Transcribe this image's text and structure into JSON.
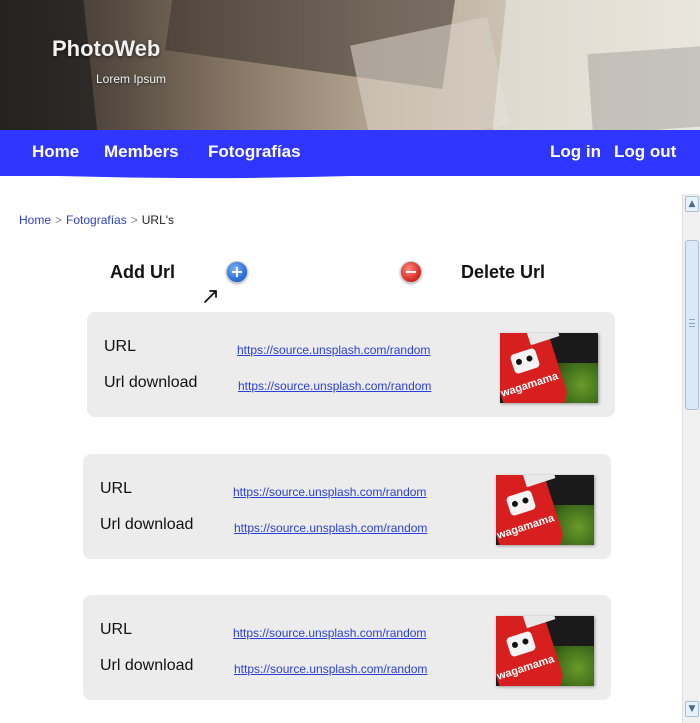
{
  "header": {
    "brand": "PhotoWeb",
    "tagline": "Lorem Ipsum"
  },
  "nav": {
    "items": [
      {
        "label": "Home"
      },
      {
        "label": "Members"
      },
      {
        "label": "Fotografías"
      }
    ],
    "login": "Log in",
    "logout": "Log out"
  },
  "breadcrumb": {
    "home": "Home",
    "section": "Fotografías",
    "current": "URL's",
    "separator": ">"
  },
  "actions": {
    "add_label": "Add Url",
    "delete_label": "Delete Url"
  },
  "cards": [
    {
      "url_label": "URL",
      "url_value": "https://source.unsplash.com/random",
      "download_label": "Url download",
      "download_value": "https://source.unsplash.com/random",
      "thumbnail_text": "wagamama"
    },
    {
      "url_label": "URL",
      "url_value": "https://source.unsplash.com/random",
      "download_label": "Url download",
      "download_value": "https://source.unsplash.com/random",
      "thumbnail_text": "wagamama"
    },
    {
      "url_label": "URL",
      "url_value": "https://source.unsplash.com/random",
      "download_label": "Url download",
      "download_value": "https://source.unsplash.com/random",
      "thumbnail_text": "wagamama"
    }
  ],
  "colors": {
    "nav_bg": "#2f36ff",
    "card_bg": "#ececec",
    "link": "#2a3fd6"
  }
}
